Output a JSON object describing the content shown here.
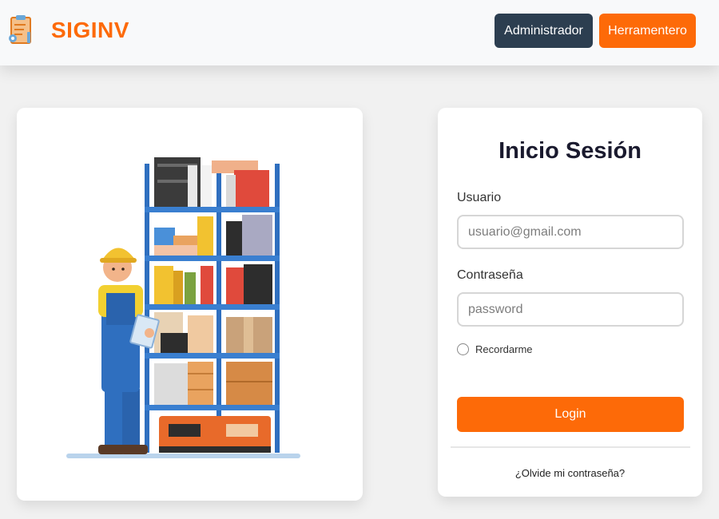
{
  "header": {
    "brand": "SIGINV",
    "admin_button": "Administrador",
    "tool_button": "Herramentero"
  },
  "login": {
    "title": "Inicio Sesión",
    "user_label": "Usuario",
    "user_placeholder": "usuario@gmail.com",
    "user_value": "",
    "password_label": "Contraseña",
    "password_placeholder": "password",
    "password_value": "",
    "remember_label": "Recordarme",
    "remember_checked": false,
    "submit_label": "Login",
    "forgot_link": "¿Olvide mi contraseña?"
  },
  "colors": {
    "accent": "#fd6a08",
    "dark_button": "#2c3e50"
  },
  "icons": {
    "brand": "clipboard-inventory-icon",
    "illustration": "warehouse-worker-illustration"
  }
}
